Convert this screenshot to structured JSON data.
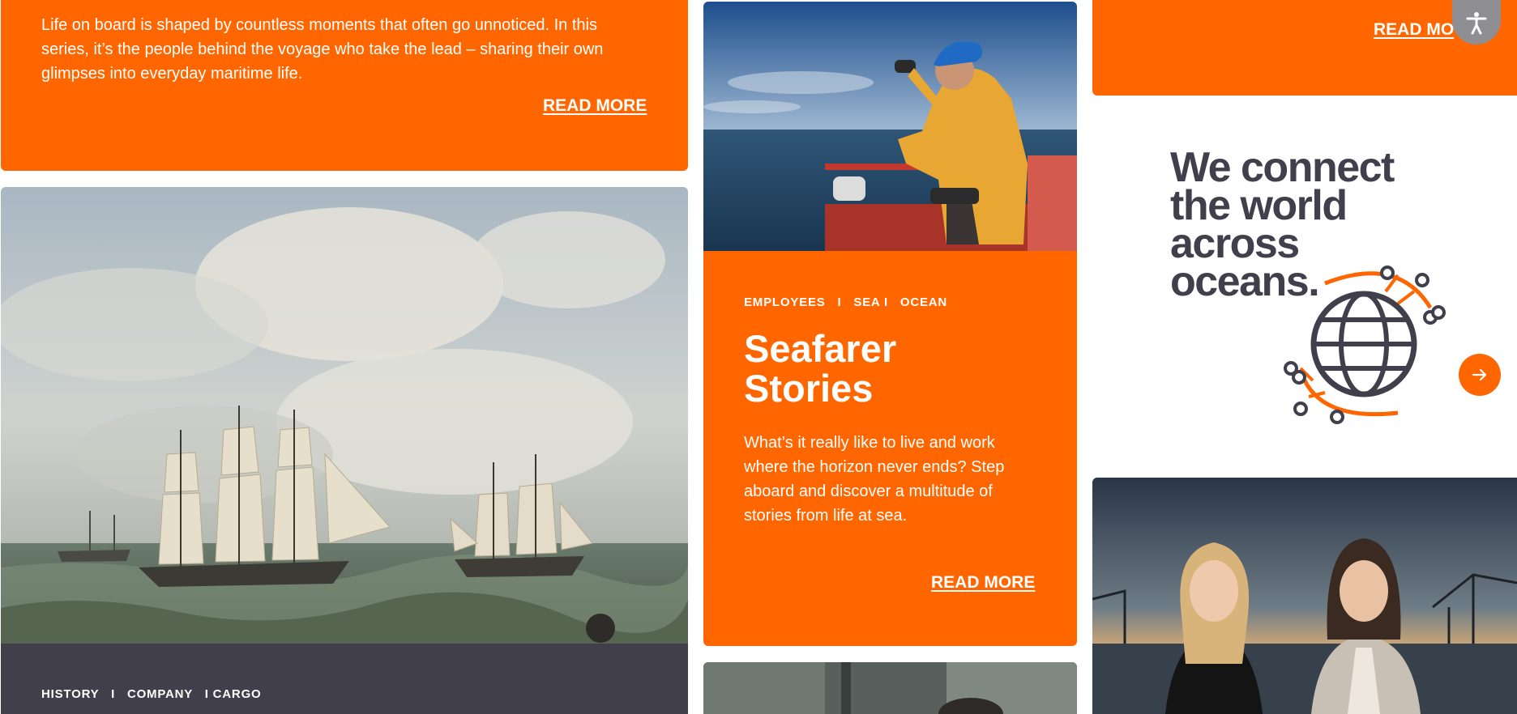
{
  "card_everyday": {
    "text": "Life on board is shaped by countless moments that often go unnoticed. In this series, it’s the people behind the voyage who take the lead – sharing their own glimpses into everyday maritime life.",
    "read_more": "READ MORE"
  },
  "card_history": {
    "tags": "HISTORY   I   COMPANY   I CARGO"
  },
  "card_seafarer": {
    "tags": "EMPLOYEES   I   SEA I   OCEAN",
    "title_line1": "Seafarer",
    "title_line2": "Stories",
    "text": "What’s it really like to live and work where the horizon never ends? Step aboard and discover a multitude of stories from life at sea.",
    "read_more": "READ MORE"
  },
  "card_top_right": {
    "read_more": "READ MO"
  },
  "connect_banner": {
    "line1": "We connect",
    "line2": "the world",
    "line3": "across",
    "line4": "oceans."
  },
  "colors": {
    "accent": "#ff6600",
    "dark": "#413f4b",
    "white": "#ffffff"
  },
  "icons": {
    "arrow": "arrow-right-icon",
    "accessibility": "accessibility-icon",
    "globe": "globe-network-icon"
  }
}
